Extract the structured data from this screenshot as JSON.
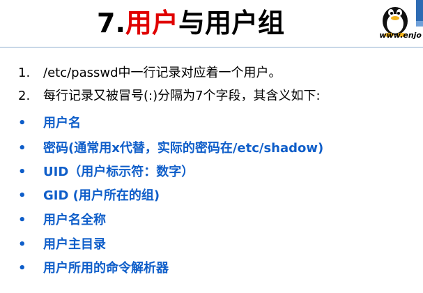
{
  "title": {
    "number": "7.",
    "accent": "用户",
    "rest": "与用户组"
  },
  "logo": {
    "text": "www.enjo",
    "icon": "penguin-icon"
  },
  "numbered": [
    {
      "marker": "1.",
      "text": "/etc/passwd中一行记录对应着一个用户。"
    },
    {
      "marker": "2.",
      "text": "每行记录又被冒号(:)分隔为7个字段，其含义如下:"
    }
  ],
  "bullets": [
    {
      "marker": "•",
      "text": "用户名"
    },
    {
      "marker": "•",
      "text": "密码(通常用x代替，实际的密码在/etc/shadow)"
    },
    {
      "marker": "•",
      "text": "UID（用户标示符：数字）"
    },
    {
      "marker": "•",
      "text": "GID (用户所在的组)"
    },
    {
      "marker": "•",
      "text": "用户名全称"
    },
    {
      "marker": "•",
      "text": "用户主目录"
    },
    {
      "marker": "•",
      "text": "用户所用的命令解析器"
    }
  ],
  "colors": {
    "title_accent": "#e00000",
    "bullet_blue": "#0f5ec9"
  }
}
